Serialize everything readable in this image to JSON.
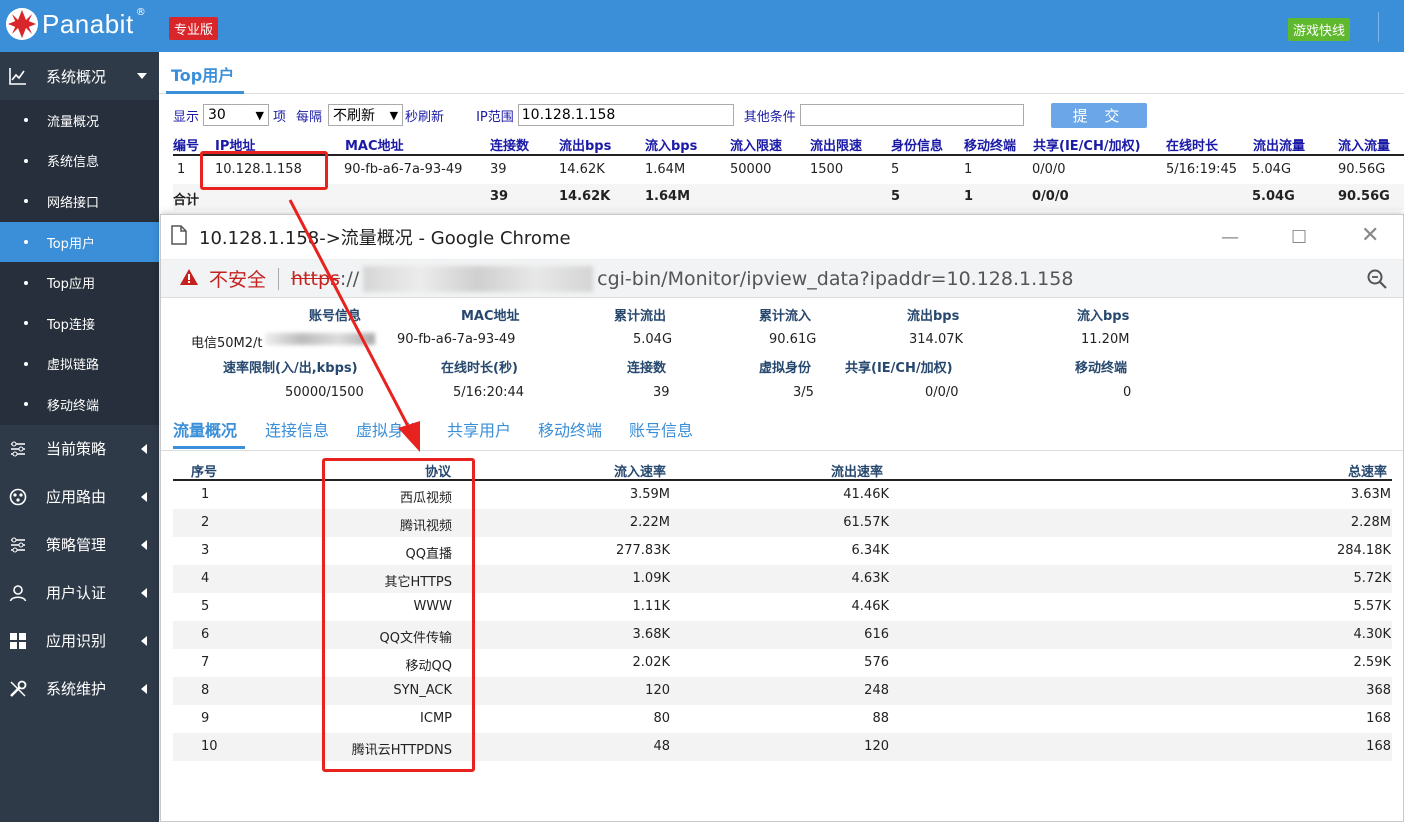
{
  "header": {
    "brand": "Panabit",
    "reg": "®",
    "edition": "专业版",
    "game_label": "游戏快线"
  },
  "sidebar": {
    "sections": [
      {
        "label": "系统概况",
        "icon": "chart-line-icon"
      },
      {
        "label": "当前策略",
        "icon": "sliders-icon"
      },
      {
        "label": "应用路由",
        "icon": "route-icon"
      },
      {
        "label": "策略管理",
        "icon": "sliders-icon"
      },
      {
        "label": "用户认证",
        "icon": "user-icon"
      },
      {
        "label": "应用识别",
        "icon": "grid-icon"
      },
      {
        "label": "系统维护",
        "icon": "wrench-icon"
      }
    ],
    "sub_items": [
      "流量概况",
      "系统信息",
      "网络接口",
      "Top用户",
      "Top应用",
      "Top连接",
      "虚拟链路",
      "移动终端"
    ]
  },
  "main": {
    "tab": "Top用户",
    "filter": {
      "show_label": "显示",
      "show_value": "30",
      "item_label": "项",
      "every_label": "每隔",
      "refresh_value": "不刷新",
      "sec_label": "秒刷新",
      "ip_label": "IP范围",
      "ip_value": "10.128.1.158",
      "other_label": "其他条件",
      "other_value": "",
      "submit": "提 交"
    },
    "table": {
      "headers": [
        "编号",
        "IP地址",
        "MAC地址",
        "连接数",
        "流出bps",
        "流入bps",
        "流入限速",
        "流出限速",
        "身份信息",
        "移动终端",
        "共享(IE/CH/加权)",
        "在线时长",
        "流出流量",
        "流入流量"
      ],
      "row": [
        "1",
        "10.128.1.158",
        "90-fb-a6-7a-93-49",
        "39",
        "14.62K",
        "1.64M",
        "50000",
        "1500",
        "5",
        "1",
        "0/0/0",
        "5/16:19:45",
        "5.04G",
        "90.56G"
      ],
      "total": [
        "合计",
        "39",
        "14.62K",
        "1.64M",
        "5",
        "1",
        "0/0/0",
        "5.04G",
        "90.56G"
      ]
    }
  },
  "popup": {
    "title": "10.128.1.158->流量概况 - Google Chrome",
    "insecure": "不安全",
    "scheme": "https",
    "scheme_sep": "://",
    "url": "cgi-bin/Monitor/ipview_data?ipaddr=10.128.1.158",
    "info": {
      "h1": [
        "账号信息",
        "MAC地址",
        "累计流出",
        "累计流入",
        "流出bps",
        "流入bps"
      ],
      "v1": [
        "电信50M2/t",
        "90-fb-a6-7a-93-49",
        "5.04G",
        "90.61G",
        "314.07K",
        "11.20M"
      ],
      "h2": [
        "速率限制(入/出,kbps)",
        "在线时长(秒)",
        "连接数",
        "虚拟身份",
        "共享(IE/CH/加权)",
        "移动终端"
      ],
      "v2": [
        "50000/1500",
        "5/16:20:44",
        "39",
        "3/5",
        "0/0/0",
        "0"
      ]
    },
    "tabs": [
      "流量概况",
      "连接信息",
      "虚拟身份",
      "共享用户",
      "移动终端",
      "账号信息"
    ],
    "table": {
      "headers": [
        "序号",
        "协议",
        "流入速率",
        "流出速率",
        "总速率"
      ],
      "rows": [
        [
          "1",
          "西瓜视频",
          "3.59M",
          "41.46K",
          "3.63M"
        ],
        [
          "2",
          "腾讯视频",
          "2.22M",
          "61.57K",
          "2.28M"
        ],
        [
          "3",
          "QQ直播",
          "277.83K",
          "6.34K",
          "284.18K"
        ],
        [
          "4",
          "其它HTTPS",
          "1.09K",
          "4.63K",
          "5.72K"
        ],
        [
          "5",
          "WWW",
          "1.11K",
          "4.46K",
          "5.57K"
        ],
        [
          "6",
          "QQ文件传输",
          "3.68K",
          "616",
          "4.30K"
        ],
        [
          "7",
          "移动QQ",
          "2.02K",
          "576",
          "2.59K"
        ],
        [
          "8",
          "SYN_ACK",
          "120",
          "248",
          "368"
        ],
        [
          "9",
          "ICMP",
          "80",
          "88",
          "168"
        ],
        [
          "10",
          "腾讯云HTTPDNS",
          "48",
          "120",
          "168"
        ]
      ]
    }
  },
  "colors": {
    "accent": "#3b8fd9",
    "sidebar": "#2f3a48",
    "annotation": "#e8231f"
  }
}
